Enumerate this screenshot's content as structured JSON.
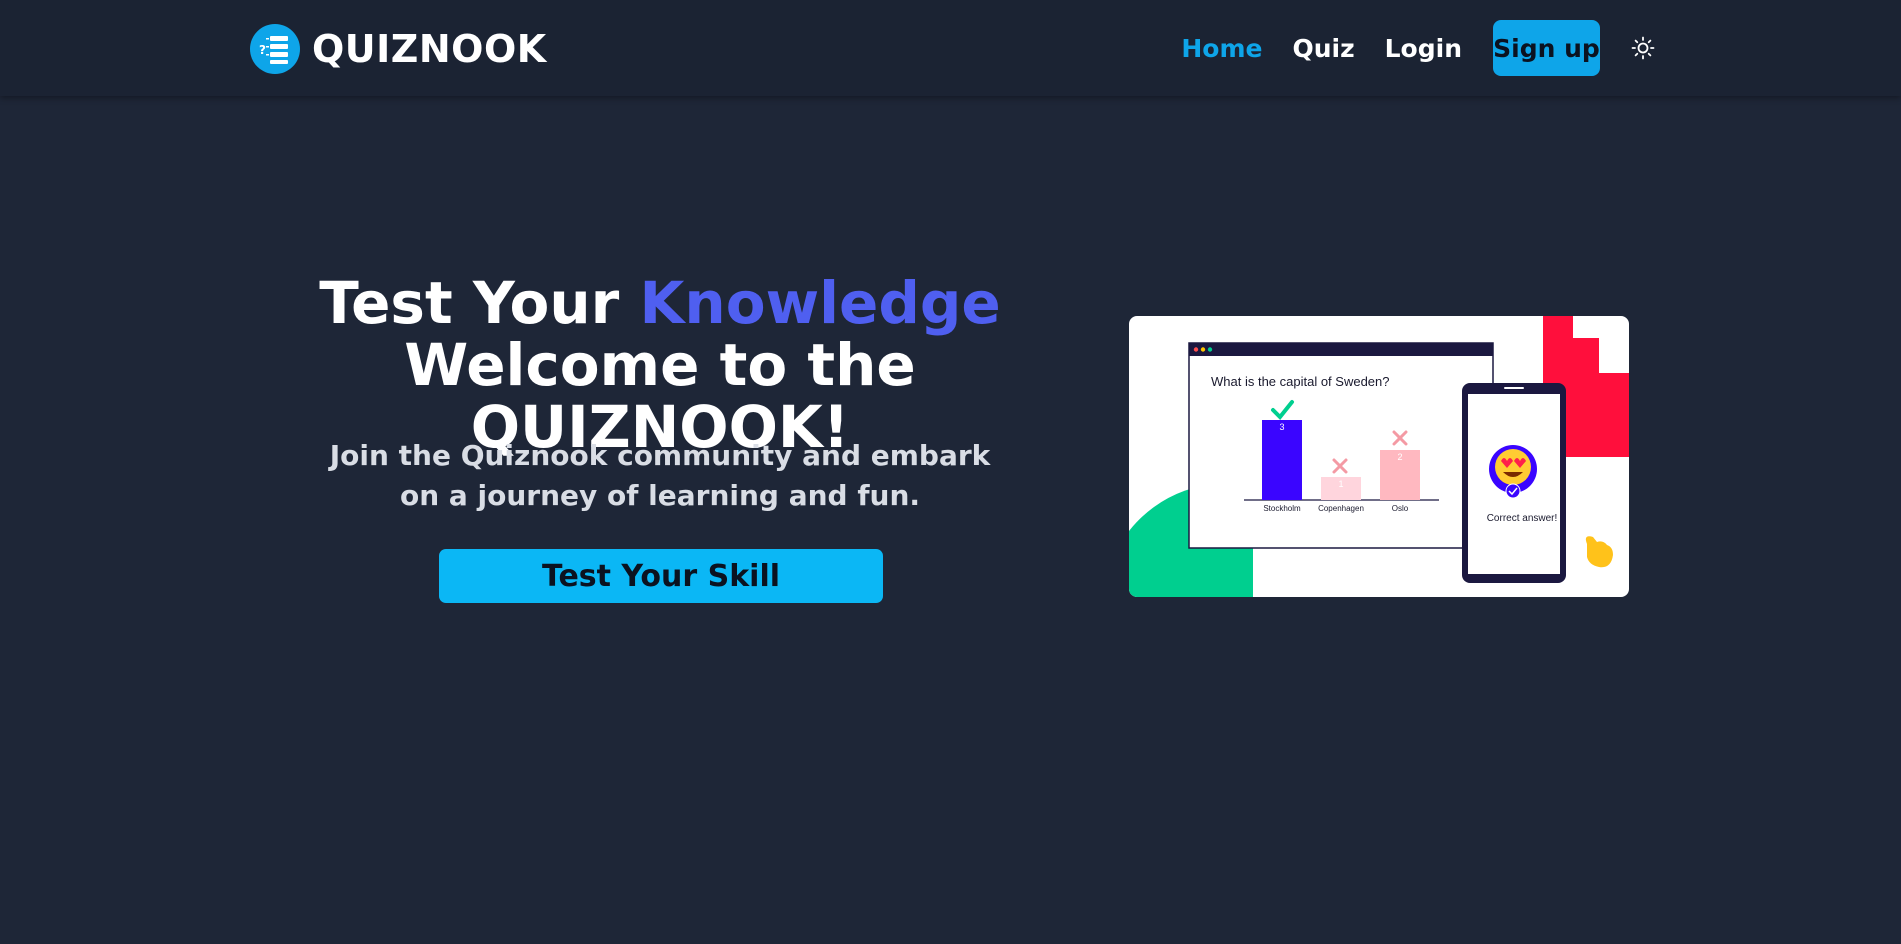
{
  "header": {
    "brand": "QUIZNOOK",
    "nav": {
      "home": "Home",
      "quiz": "Quiz",
      "login": "Login",
      "signup": "Sign up"
    },
    "theme_icon": "sun-icon"
  },
  "hero": {
    "title_line1_prefix": "Test Your ",
    "title_line1_accent": "Knowledge",
    "title_line2": "Welcome to the QUIZNOOK!",
    "subtitle_line1": "Join the Quiznook community and embark",
    "subtitle_line2": "on a journey of learning and fun.",
    "cta": "Test Your Skill"
  },
  "illustration": {
    "question": "What is the capital of Sweden?",
    "answers": [
      {
        "label": "Stockholm",
        "votes": "3"
      },
      {
        "label": "Copenhagen",
        "votes": "1"
      },
      {
        "label": "Oslo",
        "votes": "2"
      }
    ],
    "phone_text": "Correct answer!"
  },
  "colors": {
    "background": "#1e2637",
    "accent": "#0ea5e9",
    "title_accent": "#4f5ff0"
  }
}
